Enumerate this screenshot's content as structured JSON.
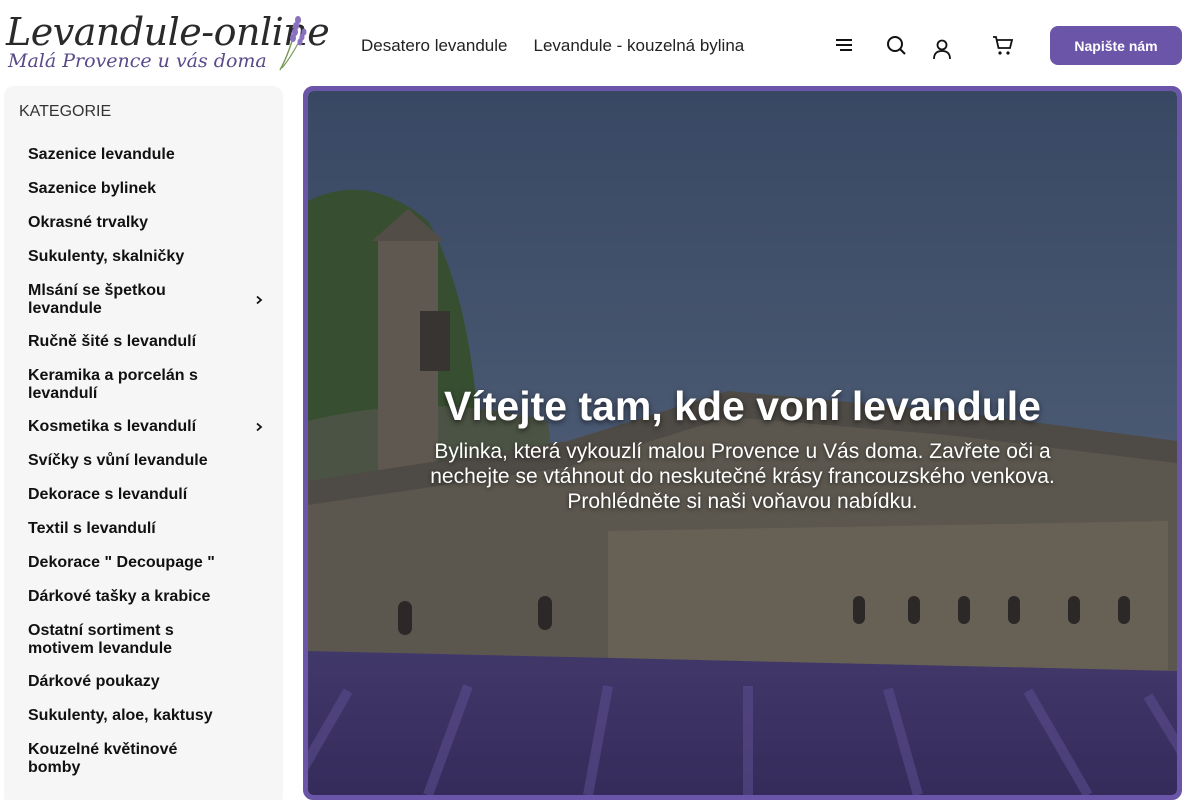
{
  "logo": {
    "title": "Levandule-online",
    "subtitle": "Malá Provence u vás doma"
  },
  "nav": {
    "items": [
      "Desatero levandule",
      "Levandule - kouzelná bylina"
    ]
  },
  "header": {
    "icons": [
      "menu-icon",
      "search-icon",
      "user-icon",
      "cart-icon"
    ],
    "contact_label": "Napište nám"
  },
  "sidebar": {
    "title": "KATEGORIE",
    "items": [
      {
        "label": "Sazenice levandule",
        "has_submenu": false
      },
      {
        "label": "Sazenice bylinek",
        "has_submenu": false
      },
      {
        "label": "Okrasné trvalky",
        "has_submenu": false
      },
      {
        "label": "Sukulenty, skalničky",
        "has_submenu": false
      },
      {
        "label": "Mlsání se špetkou levandule",
        "has_submenu": true
      },
      {
        "label": "Ručně šité s levandulí",
        "has_submenu": false
      },
      {
        "label": "Keramika a porcelán s levandulí",
        "has_submenu": false
      },
      {
        "label": "Kosmetika s levandulí",
        "has_submenu": true
      },
      {
        "label": "Svíčky s vůní levandule",
        "has_submenu": false
      },
      {
        "label": "Dekorace s levandulí",
        "has_submenu": false
      },
      {
        "label": "Textil s levandulí",
        "has_submenu": false
      },
      {
        "label": "Dekorace \" Decoupage \"",
        "has_submenu": false
      },
      {
        "label": "Dárkové tašky a krabice",
        "has_submenu": false
      },
      {
        "label": "Ostatní sortiment s motivem levandule",
        "has_submenu": false
      },
      {
        "label": "Dárkové poukazy",
        "has_submenu": false
      },
      {
        "label": "Sukulenty, aloe, kaktusy",
        "has_submenu": false
      },
      {
        "label": "Kouzelné květinové bomby",
        "has_submenu": false
      }
    ]
  },
  "hero": {
    "title": "Vítejte tam, kde voní levandule",
    "text": "Bylinka, která vykouzlí malou Provence u Vás doma. Zavřete oči a nechejte se vtáhnout do neskutečné krásy francouzského venkova. Prohlédněte si naši voňavou nabídku."
  },
  "colors": {
    "accent": "#6a55a8",
    "sidebar_bg": "#f6f6f6",
    "lavender": "#7a62b4"
  }
}
